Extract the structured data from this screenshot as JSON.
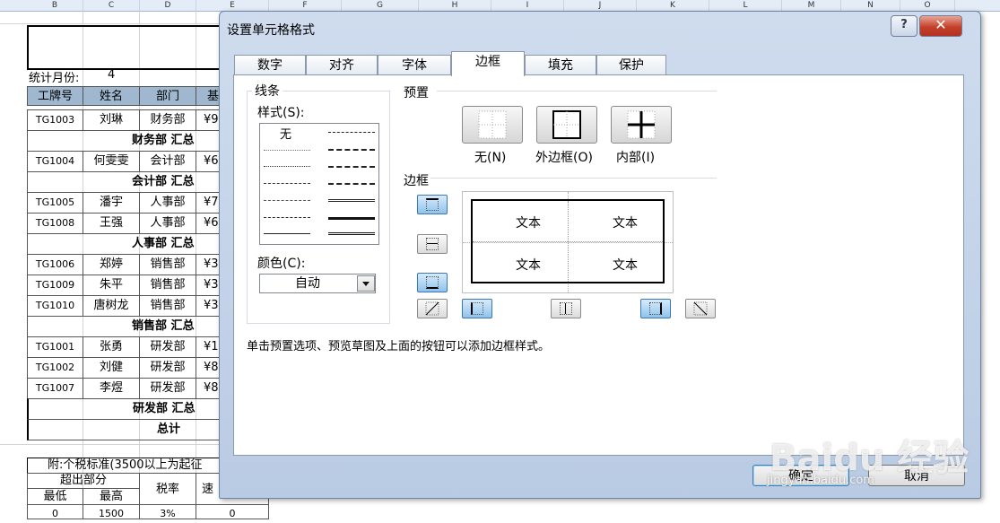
{
  "columns": [
    "B",
    "C",
    "D",
    "E",
    "F",
    "G",
    "H",
    "I",
    "J",
    "K",
    "L",
    "M",
    "N",
    "O"
  ],
  "sheet": {
    "stat_label": "统计月份:",
    "stat_value": "4",
    "headers": [
      "工牌号",
      "姓名",
      "部门",
      "基"
    ],
    "rows": [
      {
        "id": "TG1003",
        "name": "刘琳",
        "dept": "财务部",
        "sal": "¥9"
      },
      {
        "summary": "财务部 汇总"
      },
      {
        "id": "TG1004",
        "name": "何雯雯",
        "dept": "会计部",
        "sal": "¥6"
      },
      {
        "summary": "会计部 汇总"
      },
      {
        "id": "TG1005",
        "name": "潘宇",
        "dept": "人事部",
        "sal": "¥7"
      },
      {
        "id": "TG1008",
        "name": "王强",
        "dept": "人事部",
        "sal": "¥6"
      },
      {
        "summary": "人事部 汇总"
      },
      {
        "id": "TG1006",
        "name": "郑婷",
        "dept": "销售部",
        "sal": "¥3"
      },
      {
        "id": "TG1009",
        "name": "朱平",
        "dept": "销售部",
        "sal": "¥3"
      },
      {
        "id": "TG1010",
        "name": "唐树龙",
        "dept": "销售部",
        "sal": "¥3"
      },
      {
        "summary": "销售部 汇总"
      },
      {
        "id": "TG1001",
        "name": "张勇",
        "dept": "研发部",
        "sal": "¥1("
      },
      {
        "id": "TG1002",
        "name": "刘健",
        "dept": "研发部",
        "sal": "¥8"
      },
      {
        "id": "TG1007",
        "name": "李煜",
        "dept": "研发部",
        "sal": "¥8"
      },
      {
        "summary": "研发部 汇总"
      },
      {
        "summary": "总计"
      }
    ],
    "tax_title": "附:个税标准(3500以上为起征",
    "tax_sub": "超出部分",
    "tax_min": "最低",
    "tax_max": "最高",
    "tax_rate": "税率",
    "tax_quick": "速",
    "tax_row": [
      "0",
      "1500",
      "3%",
      "0"
    ]
  },
  "dialog": {
    "title": "设置单元格格式",
    "help": "?",
    "close": "✕",
    "tabs": [
      "数字",
      "对齐",
      "字体",
      "边框",
      "填充",
      "保护"
    ],
    "active_tab": "边框",
    "line_group": "线条",
    "style_label": "样式(S):",
    "style_none": "无",
    "color_label": "颜色(C):",
    "color_value": "自动",
    "presets_label": "预置",
    "preset_none": "无(N)",
    "preset_outline": "外边框(O)",
    "preset_inside": "内部(I)",
    "border_label": "边框",
    "preview_text": [
      "文本",
      "文本",
      "文本",
      "文本"
    ],
    "hint": "单击预置选项、预览草图及上面的按钮可以添加边框样式。",
    "ok": "确定",
    "cancel": "取消"
  },
  "watermark": {
    "text": "Baidu 经验",
    "url": "jingyan.baidu.com"
  }
}
